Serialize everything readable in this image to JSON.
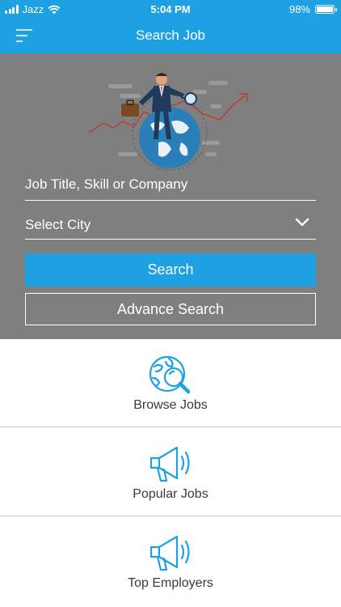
{
  "status_bar": {
    "carrier": "Jazz",
    "time": "5:04 PM",
    "battery": "98%",
    "battery_level": 0.98
  },
  "nav": {
    "title": "Search Job",
    "menu_icon": "hamburger-menu-icon"
  },
  "search": {
    "job_placeholder": "Job Title, Skill or Company",
    "city_value": "Select City",
    "search_label": "Search",
    "advance_label": "Advance Search"
  },
  "menu": {
    "items": [
      {
        "label": "Browse Jobs",
        "icon": "globe-search-icon"
      },
      {
        "label": "Popular Jobs",
        "icon": "megaphone-icon"
      },
      {
        "label": "Top Employers",
        "icon": "megaphone-icon"
      }
    ]
  },
  "colors": {
    "primary": "#1da1e2",
    "hero_bg": "#7f7f7f",
    "divider": "#c8c8c8"
  }
}
